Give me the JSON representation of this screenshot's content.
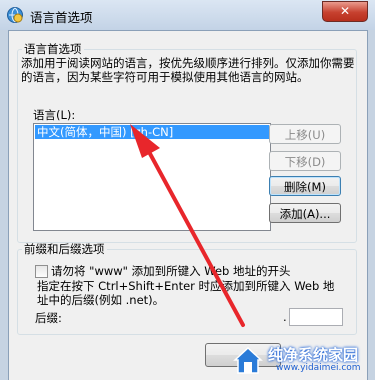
{
  "window": {
    "title": "语言首选项",
    "close_glyph": "✕"
  },
  "language_group": {
    "legend": "语言首选项",
    "description": "添加用于阅读网站的语言，按优先级顺序进行排列。仅添加你需要的语言，因为某些字符可用于模拟使用其他语言的网站。",
    "list_label": "语言(L):",
    "languages": [
      "中文(简体，中国) [zh-CN]"
    ],
    "buttons": {
      "move_up": "上移(U)",
      "move_down": "下移(D)",
      "remove": "删除(M)",
      "add": "添加(A)..."
    }
  },
  "prefix_group": {
    "legend": "前缀和后缀选项",
    "checkbox_label": "请勿将 \"www\" 添加到所键入 Web 地址的开头",
    "hint": "指定在按下 Ctrl+Shift+Enter 时应添加到所键入 Web 地址中的后缀(例如 .net)。",
    "suffix_label": "后缀:",
    "suffix_dot": ".",
    "suffix_value": ""
  },
  "watermark": {
    "name": "纯净系统家园",
    "url": "www.yidaimei.com"
  },
  "colors": {
    "selection": "#3399ff",
    "arrow": "#e8262b"
  }
}
